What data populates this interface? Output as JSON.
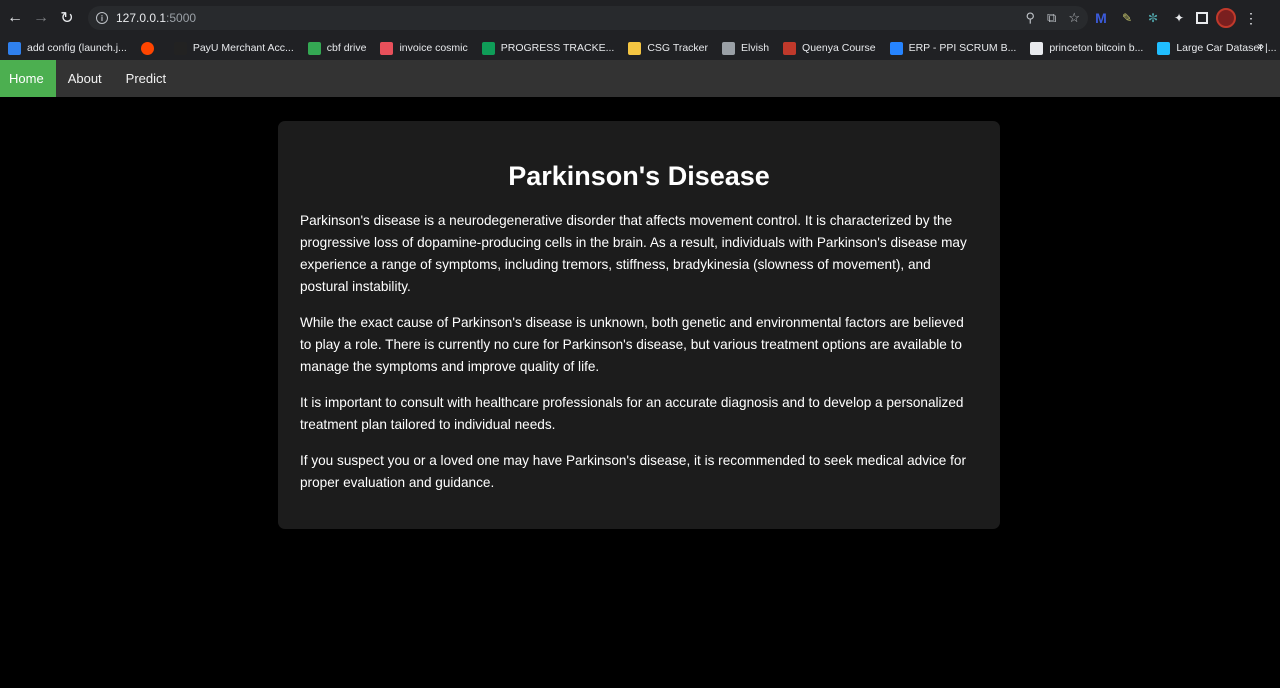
{
  "browser": {
    "url_host": "127.0.0.1",
    "url_port": ":5000",
    "bookmarks": [
      {
        "label": "add config (launch.j...",
        "icon": "vscode-icon",
        "color": "#2f80ed"
      },
      {
        "label": "",
        "icon": "reddit-icon",
        "color": "#ff4500"
      },
      {
        "label": "PayU Merchant Acc...",
        "icon": "payu-icon",
        "color": "#222222"
      },
      {
        "label": "cbf drive",
        "icon": "google-drive-icon",
        "color": "#34a853"
      },
      {
        "label": "invoice cosmic",
        "icon": "cosmic-icon",
        "color": "#e8505b"
      },
      {
        "label": "PROGRESS TRACKE...",
        "icon": "sheets-icon",
        "color": "#0f9d58"
      },
      {
        "label": "CSG Tracker",
        "icon": "keep-icon",
        "color": "#f4c542"
      },
      {
        "label": "Elvish",
        "icon": "elvish-icon",
        "color": "#9aa0a6"
      },
      {
        "label": "Quenya Course",
        "icon": "quenya-icon",
        "color": "#c0392b"
      },
      {
        "label": "ERP - PPI SCRUM B...",
        "icon": "jira-icon",
        "color": "#2684ff"
      },
      {
        "label": "princeton bitcoin b...",
        "icon": "globe-icon",
        "color": "#e8eaed"
      },
      {
        "label": "Large Car Dataset |...",
        "icon": "kaggle-icon",
        "color": "#20beff"
      }
    ],
    "more": "»"
  },
  "nav": {
    "home": "Home",
    "about": "About",
    "predict": "Predict",
    "active_color": "#4caf50"
  },
  "content": {
    "title": "Parkinson's Disease",
    "paragraphs": [
      "Parkinson's disease is a neurodegenerative disorder that affects movement control. It is characterized by the progressive loss of dopamine-producing cells in the brain. As a result, individuals with Parkinson's disease may experience a range of symptoms, including tremors, stiffness, bradykinesia (slowness of movement), and postural instability.",
      "While the exact cause of Parkinson's disease is unknown, both genetic and environmental factors are believed to play a role. There is currently no cure for Parkinson's disease, but various treatment options are available to manage the symptoms and improve quality of life.",
      "It is important to consult with healthcare professionals for an accurate diagnosis and to develop a personalized treatment plan tailored to individual needs.",
      "If you suspect you or a loved one may have Parkinson's disease, it is recommended to seek medical advice for proper evaluation and guidance."
    ]
  }
}
